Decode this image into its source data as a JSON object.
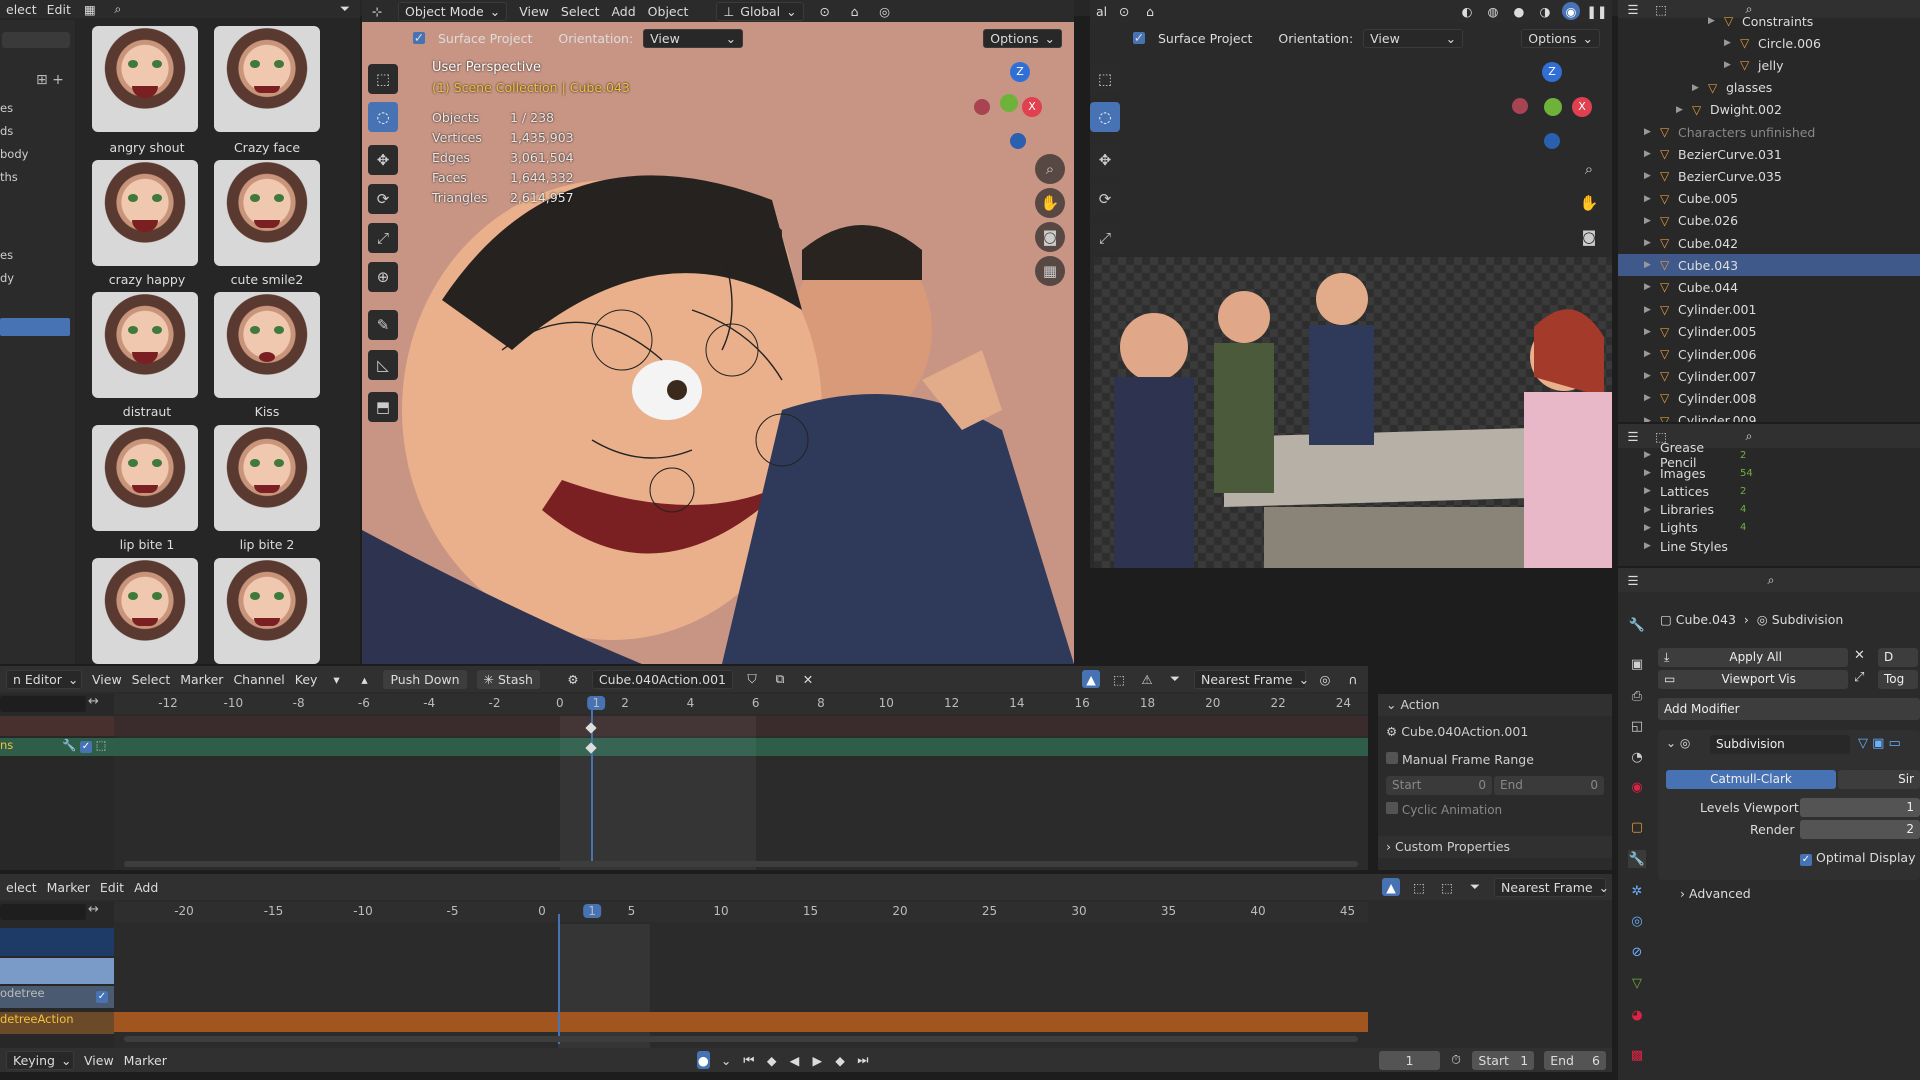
{
  "top_bar": {
    "left_menu": [
      "elect",
      "Edit"
    ],
    "mode": "Object Mode",
    "menus": [
      "View",
      "Select",
      "Add",
      "Object"
    ],
    "transform_orientation": "Global",
    "right_orientation": "al"
  },
  "asset_browser": {
    "left_items": [
      "es",
      "ds",
      "body",
      "ths",
      "es",
      "dy"
    ],
    "thumbnails": [
      {
        "label": "angry shout"
      },
      {
        "label": "Crazy face"
      },
      {
        "label": "crazy happy"
      },
      {
        "label": "cute smile2"
      },
      {
        "label": "distraut"
      },
      {
        "label": "Kiss"
      },
      {
        "label": "lip bite 1"
      },
      {
        "label": "lip bite 2"
      },
      {
        "label": ""
      },
      {
        "label": ""
      }
    ]
  },
  "viewport_left": {
    "surface_project": "Surface Project",
    "orientation_label": "Orientation:",
    "orientation_value": "View",
    "options": "Options",
    "perspective": "User Perspective",
    "collection": "(1) Scene Collection | Cube.043",
    "stats": [
      {
        "label": "Objects",
        "value": "1 / 238"
      },
      {
        "label": "Vertices",
        "value": "1,435,903"
      },
      {
        "label": "Edges",
        "value": "3,061,504"
      },
      {
        "label": "Faces",
        "value": "1,644,332"
      },
      {
        "label": "Triangles",
        "value": "2,614,957"
      }
    ],
    "gizmo": {
      "z": "Z",
      "y": "Y",
      "x": "X"
    }
  },
  "viewport_right": {
    "surface_project": "Surface Project",
    "orientation_label": "Orientation:",
    "orientation_value": "View",
    "options": "Options",
    "gizmo": {
      "z": "Z",
      "y": "Y",
      "x": "X"
    }
  },
  "action_editor": {
    "editor_label": "n Editor",
    "menus": [
      "View",
      "Select",
      "Marker",
      "Channel",
      "Key"
    ],
    "push_down": "Push Down",
    "stash": "Stash",
    "action_name": "Cube.040Action.001",
    "snap": "Nearest Frame",
    "ruler": [
      "-12",
      "-10",
      "-8",
      "-6",
      "-4",
      "-2",
      "0",
      "1",
      "2",
      "4",
      "6",
      "8",
      "10",
      "12",
      "14",
      "16",
      "18",
      "20",
      "22",
      "24"
    ],
    "current_frame": "1",
    "channel_label": "ns"
  },
  "action_panel": {
    "section": "Action",
    "action_name": "Cube.040Action.001",
    "manual_frame_range": "Manual Frame Range",
    "start_label": "Start",
    "start_value": "0",
    "end_label": "End",
    "end_value": "0",
    "cyclic": "Cyclic Animation",
    "custom_properties": "Custom Properties"
  },
  "nla_editor": {
    "menus": [
      "elect",
      "Marker",
      "Edit",
      "Add"
    ],
    "snap": "Nearest Frame",
    "ruler": [
      "-20",
      "-15",
      "-10",
      "-5",
      "0",
      "1",
      "5",
      "10",
      "15",
      "20",
      "25",
      "30",
      "35",
      "40",
      "45"
    ],
    "current_frame": "1",
    "tracks": [
      "",
      "",
      "odetree",
      "detreeAction"
    ]
  },
  "playback_bar": {
    "keying": "Keying",
    "view": "View",
    "marker": "Marker",
    "frame": "1",
    "start_label": "Start",
    "start_value": "1",
    "end_label": "End",
    "end_value": "6"
  },
  "outliner": {
    "rows": [
      {
        "name": "Constraints",
        "indent": 5
      },
      {
        "name": "Circle.006",
        "indent": 6
      },
      {
        "name": "jelly",
        "indent": 6
      },
      {
        "name": "glasses",
        "indent": 4
      },
      {
        "name": "Dwight.002",
        "indent": 3
      },
      {
        "name": "Characters unfinished",
        "indent": 1
      },
      {
        "name": "BezierCurve.031",
        "indent": 1
      },
      {
        "name": "BezierCurve.035",
        "indent": 1
      },
      {
        "name": "Cube.005",
        "indent": 1
      },
      {
        "name": "Cube.026",
        "indent": 1
      },
      {
        "name": "Cube.042",
        "indent": 1
      },
      {
        "name": "Cube.043",
        "indent": 1,
        "selected": true
      },
      {
        "name": "Cube.044",
        "indent": 1
      },
      {
        "name": "Cylinder.001",
        "indent": 1
      },
      {
        "name": "Cylinder.005",
        "indent": 1
      },
      {
        "name": "Cylinder.006",
        "indent": 1
      },
      {
        "name": "Cylinder.007",
        "indent": 1
      },
      {
        "name": "Cylinder.008",
        "indent": 1
      },
      {
        "name": "Cylinder.009",
        "indent": 1
      }
    ]
  },
  "data_browser": {
    "rows": [
      {
        "name": "Grease Pencil",
        "count": "2"
      },
      {
        "name": "Images",
        "count": "54"
      },
      {
        "name": "Lattices",
        "count": "2"
      },
      {
        "name": "Libraries",
        "count": "4"
      },
      {
        "name": "Lights",
        "count": "4"
      },
      {
        "name": "Line Styles",
        "count": ""
      }
    ]
  },
  "properties": {
    "object": "Cube.043",
    "modifier_crumb": "Subdivision",
    "apply_all": "Apply All",
    "viewport_vis": "Viewport Vis",
    "tog": "Tog",
    "add_modifier": "Add Modifier",
    "modifier_name": "Subdivision",
    "catmull_clark": "Catmull-Clark",
    "simple": "Sir",
    "levels_viewport_label": "Levels Viewport",
    "levels_viewport_value": "1",
    "render_label": "Render",
    "render_value": "2",
    "optimal_display": "Optimal Display",
    "advanced": "Advanced",
    "d_label": "D"
  },
  "colors": {
    "accent": "#4772b3",
    "selected_row": "#3f5a8a",
    "viewport_bg": "#c89584",
    "nla_track_orange": "#a0561e",
    "keyframe_channel_green": "#2e5d4a"
  }
}
